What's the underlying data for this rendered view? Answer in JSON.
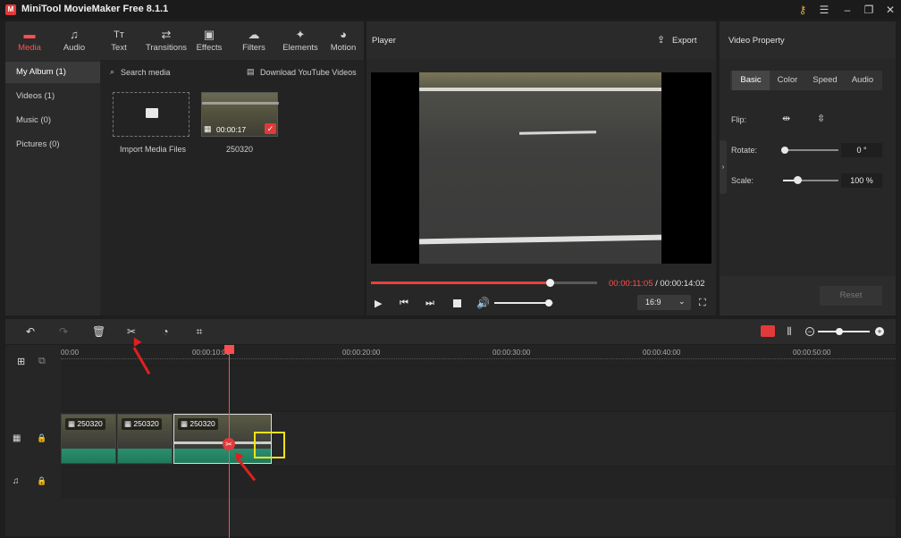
{
  "window": {
    "title": "MiniTool MovieMaker Free 8.1.1"
  },
  "tabs": [
    {
      "label": "Media",
      "icon": "folder-icon"
    },
    {
      "label": "Audio",
      "icon": "music-note-icon"
    },
    {
      "label": "Text",
      "icon": "text-icon"
    },
    {
      "label": "Transitions",
      "icon": "transitions-icon"
    },
    {
      "label": "Effects",
      "icon": "effects-icon"
    },
    {
      "label": "Filters",
      "icon": "filters-icon"
    },
    {
      "label": "Elements",
      "icon": "elements-icon"
    },
    {
      "label": "Motion",
      "icon": "motion-icon"
    }
  ],
  "sidebar": {
    "items": [
      {
        "label": "My Album (1)"
      },
      {
        "label": "Videos (1)"
      },
      {
        "label": "Music (0)"
      },
      {
        "label": "Pictures (0)"
      }
    ]
  },
  "media": {
    "search_placeholder": "Search media",
    "download_label": "Download YouTube Videos",
    "import_label": "Import Media Files",
    "clip_name": "250320",
    "clip_duration": "00:00:17"
  },
  "player": {
    "title": "Player",
    "export_label": "Export",
    "current_time": "00:00:11:05",
    "separator": " / ",
    "total_time": "00:00:14:02",
    "aspect": "16:9",
    "progress": 0.79,
    "volume": 0.92
  },
  "property": {
    "title": "Video Property",
    "tabs": [
      "Basic",
      "Color",
      "Speed",
      "Audio"
    ],
    "flip_label": "Flip:",
    "rotate_label": "Rotate:",
    "rotate_value": "0 °",
    "scale_label": "Scale:",
    "scale_value": "100 %",
    "reset_label": "Reset"
  },
  "timeline": {
    "ticks": [
      "00:00",
      "00:00:10:00",
      "00:00:20:00",
      "00:00:30:00",
      "00:00:40:00",
      "00:00:50:00"
    ],
    "clips": [
      {
        "name": "250320"
      },
      {
        "name": "250320"
      },
      {
        "name": "250320"
      }
    ]
  },
  "colors": {
    "accent": "#ff4d4d",
    "waveform": "#2a8f6e",
    "highlight_box": "#f2e21a"
  }
}
